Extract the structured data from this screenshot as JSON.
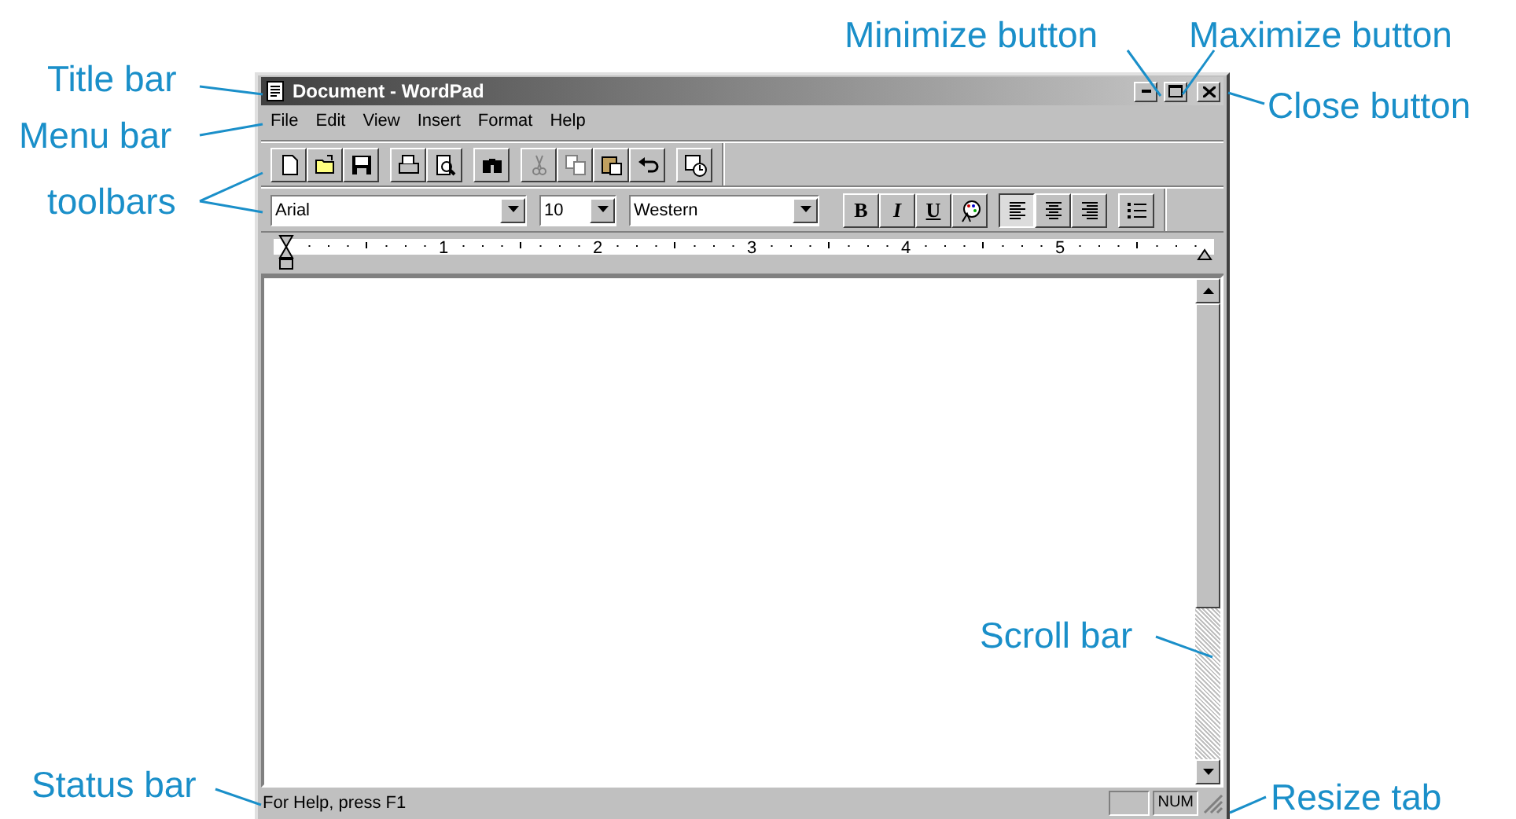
{
  "window": {
    "title": "Document - WordPad"
  },
  "menu": [
    "File",
    "Edit",
    "View",
    "Insert",
    "Format",
    "Help"
  ],
  "toolbar": [
    {
      "kind": "new",
      "disabled": false
    },
    {
      "kind": "open",
      "disabled": false
    },
    {
      "kind": "save",
      "disabled": false
    },
    {
      "kind": "print",
      "disabled": false
    },
    {
      "kind": "preview",
      "disabled": false
    },
    {
      "kind": "find",
      "disabled": false
    },
    {
      "kind": "cut",
      "disabled": true
    },
    {
      "kind": "copy",
      "disabled": true
    },
    {
      "kind": "paste",
      "disabled": false
    },
    {
      "kind": "undo",
      "disabled": false
    },
    {
      "kind": "datetime",
      "disabled": false
    }
  ],
  "format_bar": {
    "font": "Arial",
    "size": "10",
    "script": "Western",
    "style_buttons": [
      {
        "kind": "bold",
        "label": "B"
      },
      {
        "kind": "italic",
        "label": "I"
      },
      {
        "kind": "underline",
        "label": "U"
      },
      {
        "kind": "color"
      }
    ],
    "align_buttons": [
      {
        "kind": "left",
        "selected": true
      },
      {
        "kind": "center",
        "selected": false
      },
      {
        "kind": "right",
        "selected": false
      }
    ],
    "bullets": {
      "kind": "bullets"
    }
  },
  "ruler": {
    "numbers": [
      "1",
      "2",
      "3",
      "4",
      "5"
    ]
  },
  "status_bar": {
    "text": "For Help, press F1",
    "panels": [
      "NUM"
    ]
  },
  "callouts": [
    {
      "text": "Title bar"
    },
    {
      "text": "Menu bar"
    },
    {
      "text": "toolbars"
    },
    {
      "text": "Minimize button"
    },
    {
      "text": "Maximize button"
    },
    {
      "text": "Close button"
    },
    {
      "text": "Scroll bar"
    },
    {
      "text": "Status bar"
    },
    {
      "text": "Resize tab"
    }
  ]
}
